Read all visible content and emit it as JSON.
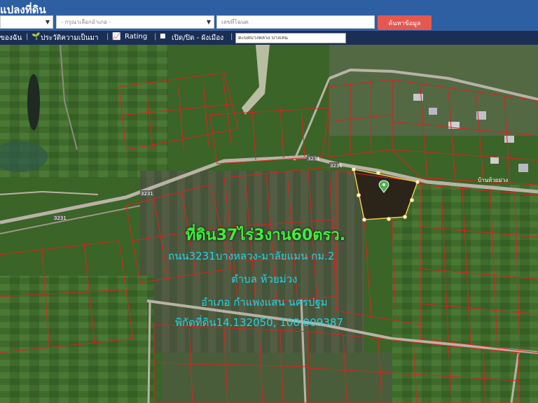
{
  "header": {
    "title": "แปลงที่ดิน",
    "province_select": "",
    "district_select": "- กรุณาเลือกอำเภอ -",
    "parcel_input_placeholder": "เลขที่โฉนด",
    "search_button": "ค้นหาข้อมูล"
  },
  "toolbar": {
    "item1": "ของฉัน",
    "item2": "ประวัติความเป็นมา",
    "item3": "Rating",
    "item4": "เปิด/ปิด - ผังเมือง",
    "location_input": "ตะบตบางหลวง บางเลน"
  },
  "map": {
    "road_labels": [
      "3231",
      "3231",
      "3231",
      "3231"
    ],
    "village_label": "บ้านห้วยม่วง"
  },
  "overlay": {
    "line1": "ที่ดิน37ไร่3งาน60ตรว.",
    "line2": "ถนน3231บางหลวง-มาลัยแมน กม.2",
    "line3": "ตำบล ห้วยม่วง",
    "line4": "อำเภอ กำแพงแสน นครปฐม",
    "line5": "พิกัดที่ดิน14.132050, 100.009387"
  },
  "colors": {
    "header": "#2f5fa3",
    "toolbar": "#1b2f55",
    "button": "#e4584f",
    "parcel_lines": "#e02020",
    "highlight_parcel": "#f0c850",
    "overlay_green": "#3dee3d",
    "overlay_cyan": "#1fd7e5"
  }
}
